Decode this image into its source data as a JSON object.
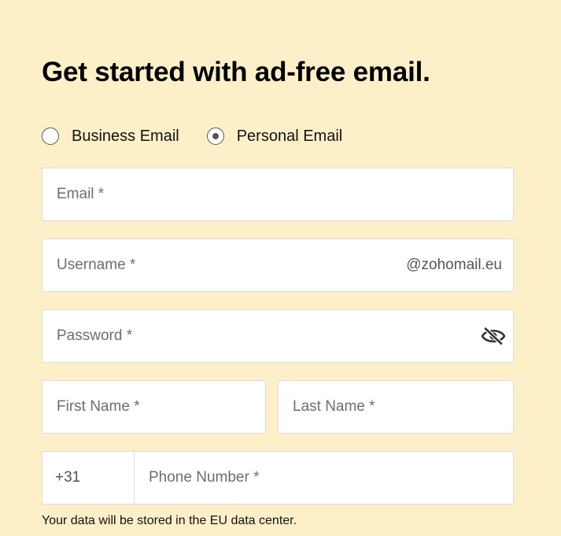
{
  "heading": "Get started with ad-free email.",
  "account_type": {
    "options": [
      {
        "label": "Business Email",
        "selected": false
      },
      {
        "label": "Personal Email",
        "selected": true
      }
    ]
  },
  "fields": {
    "email": {
      "placeholder": "Email *",
      "value": ""
    },
    "username": {
      "placeholder": "Username *",
      "value": "",
      "suffix": "@zohomail.eu"
    },
    "password": {
      "placeholder": "Password *",
      "value": "",
      "toggle_icon": "eye-slash-icon"
    },
    "first_name": {
      "placeholder": "First Name *",
      "value": ""
    },
    "last_name": {
      "placeholder": "Last Name *",
      "value": ""
    },
    "phone": {
      "country_code": "+31",
      "placeholder": "Phone Number *",
      "value": ""
    }
  },
  "data_note": "Your data will be stored in the EU data center.",
  "colors": {
    "background": "#fdf0c8",
    "field_background": "#ffffff",
    "field_border": "#dcdcdc",
    "heading_text": "#000000"
  }
}
